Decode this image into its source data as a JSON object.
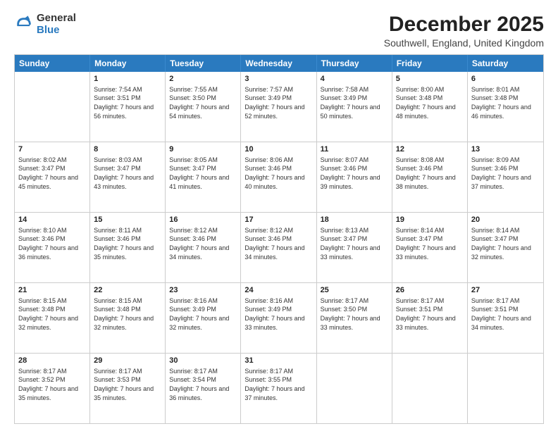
{
  "logo": {
    "general": "General",
    "blue": "Blue"
  },
  "title": "December 2025",
  "subtitle": "Southwell, England, United Kingdom",
  "calendar": {
    "headers": [
      "Sunday",
      "Monday",
      "Tuesday",
      "Wednesday",
      "Thursday",
      "Friday",
      "Saturday"
    ],
    "rows": [
      [
        {
          "day": "",
          "sunrise": "",
          "sunset": "",
          "daylight": ""
        },
        {
          "day": "1",
          "sunrise": "Sunrise: 7:54 AM",
          "sunset": "Sunset: 3:51 PM",
          "daylight": "Daylight: 7 hours and 56 minutes."
        },
        {
          "day": "2",
          "sunrise": "Sunrise: 7:55 AM",
          "sunset": "Sunset: 3:50 PM",
          "daylight": "Daylight: 7 hours and 54 minutes."
        },
        {
          "day": "3",
          "sunrise": "Sunrise: 7:57 AM",
          "sunset": "Sunset: 3:49 PM",
          "daylight": "Daylight: 7 hours and 52 minutes."
        },
        {
          "day": "4",
          "sunrise": "Sunrise: 7:58 AM",
          "sunset": "Sunset: 3:49 PM",
          "daylight": "Daylight: 7 hours and 50 minutes."
        },
        {
          "day": "5",
          "sunrise": "Sunrise: 8:00 AM",
          "sunset": "Sunset: 3:48 PM",
          "daylight": "Daylight: 7 hours and 48 minutes."
        },
        {
          "day": "6",
          "sunrise": "Sunrise: 8:01 AM",
          "sunset": "Sunset: 3:48 PM",
          "daylight": "Daylight: 7 hours and 46 minutes."
        }
      ],
      [
        {
          "day": "7",
          "sunrise": "Sunrise: 8:02 AM",
          "sunset": "Sunset: 3:47 PM",
          "daylight": "Daylight: 7 hours and 45 minutes."
        },
        {
          "day": "8",
          "sunrise": "Sunrise: 8:03 AM",
          "sunset": "Sunset: 3:47 PM",
          "daylight": "Daylight: 7 hours and 43 minutes."
        },
        {
          "day": "9",
          "sunrise": "Sunrise: 8:05 AM",
          "sunset": "Sunset: 3:47 PM",
          "daylight": "Daylight: 7 hours and 41 minutes."
        },
        {
          "day": "10",
          "sunrise": "Sunrise: 8:06 AM",
          "sunset": "Sunset: 3:46 PM",
          "daylight": "Daylight: 7 hours and 40 minutes."
        },
        {
          "day": "11",
          "sunrise": "Sunrise: 8:07 AM",
          "sunset": "Sunset: 3:46 PM",
          "daylight": "Daylight: 7 hours and 39 minutes."
        },
        {
          "day": "12",
          "sunrise": "Sunrise: 8:08 AM",
          "sunset": "Sunset: 3:46 PM",
          "daylight": "Daylight: 7 hours and 38 minutes."
        },
        {
          "day": "13",
          "sunrise": "Sunrise: 8:09 AM",
          "sunset": "Sunset: 3:46 PM",
          "daylight": "Daylight: 7 hours and 37 minutes."
        }
      ],
      [
        {
          "day": "14",
          "sunrise": "Sunrise: 8:10 AM",
          "sunset": "Sunset: 3:46 PM",
          "daylight": "Daylight: 7 hours and 36 minutes."
        },
        {
          "day": "15",
          "sunrise": "Sunrise: 8:11 AM",
          "sunset": "Sunset: 3:46 PM",
          "daylight": "Daylight: 7 hours and 35 minutes."
        },
        {
          "day": "16",
          "sunrise": "Sunrise: 8:12 AM",
          "sunset": "Sunset: 3:46 PM",
          "daylight": "Daylight: 7 hours and 34 minutes."
        },
        {
          "day": "17",
          "sunrise": "Sunrise: 8:12 AM",
          "sunset": "Sunset: 3:46 PM",
          "daylight": "Daylight: 7 hours and 34 minutes."
        },
        {
          "day": "18",
          "sunrise": "Sunrise: 8:13 AM",
          "sunset": "Sunset: 3:47 PM",
          "daylight": "Daylight: 7 hours and 33 minutes."
        },
        {
          "day": "19",
          "sunrise": "Sunrise: 8:14 AM",
          "sunset": "Sunset: 3:47 PM",
          "daylight": "Daylight: 7 hours and 33 minutes."
        },
        {
          "day": "20",
          "sunrise": "Sunrise: 8:14 AM",
          "sunset": "Sunset: 3:47 PM",
          "daylight": "Daylight: 7 hours and 32 minutes."
        }
      ],
      [
        {
          "day": "21",
          "sunrise": "Sunrise: 8:15 AM",
          "sunset": "Sunset: 3:48 PM",
          "daylight": "Daylight: 7 hours and 32 minutes."
        },
        {
          "day": "22",
          "sunrise": "Sunrise: 8:15 AM",
          "sunset": "Sunset: 3:48 PM",
          "daylight": "Daylight: 7 hours and 32 minutes."
        },
        {
          "day": "23",
          "sunrise": "Sunrise: 8:16 AM",
          "sunset": "Sunset: 3:49 PM",
          "daylight": "Daylight: 7 hours and 32 minutes."
        },
        {
          "day": "24",
          "sunrise": "Sunrise: 8:16 AM",
          "sunset": "Sunset: 3:49 PM",
          "daylight": "Daylight: 7 hours and 33 minutes."
        },
        {
          "day": "25",
          "sunrise": "Sunrise: 8:17 AM",
          "sunset": "Sunset: 3:50 PM",
          "daylight": "Daylight: 7 hours and 33 minutes."
        },
        {
          "day": "26",
          "sunrise": "Sunrise: 8:17 AM",
          "sunset": "Sunset: 3:51 PM",
          "daylight": "Daylight: 7 hours and 33 minutes."
        },
        {
          "day": "27",
          "sunrise": "Sunrise: 8:17 AM",
          "sunset": "Sunset: 3:51 PM",
          "daylight": "Daylight: 7 hours and 34 minutes."
        }
      ],
      [
        {
          "day": "28",
          "sunrise": "Sunrise: 8:17 AM",
          "sunset": "Sunset: 3:52 PM",
          "daylight": "Daylight: 7 hours and 35 minutes."
        },
        {
          "day": "29",
          "sunrise": "Sunrise: 8:17 AM",
          "sunset": "Sunset: 3:53 PM",
          "daylight": "Daylight: 7 hours and 35 minutes."
        },
        {
          "day": "30",
          "sunrise": "Sunrise: 8:17 AM",
          "sunset": "Sunset: 3:54 PM",
          "daylight": "Daylight: 7 hours and 36 minutes."
        },
        {
          "day": "31",
          "sunrise": "Sunrise: 8:17 AM",
          "sunset": "Sunset: 3:55 PM",
          "daylight": "Daylight: 7 hours and 37 minutes."
        },
        {
          "day": "",
          "sunrise": "",
          "sunset": "",
          "daylight": ""
        },
        {
          "day": "",
          "sunrise": "",
          "sunset": "",
          "daylight": ""
        },
        {
          "day": "",
          "sunrise": "",
          "sunset": "",
          "daylight": ""
        }
      ]
    ]
  }
}
